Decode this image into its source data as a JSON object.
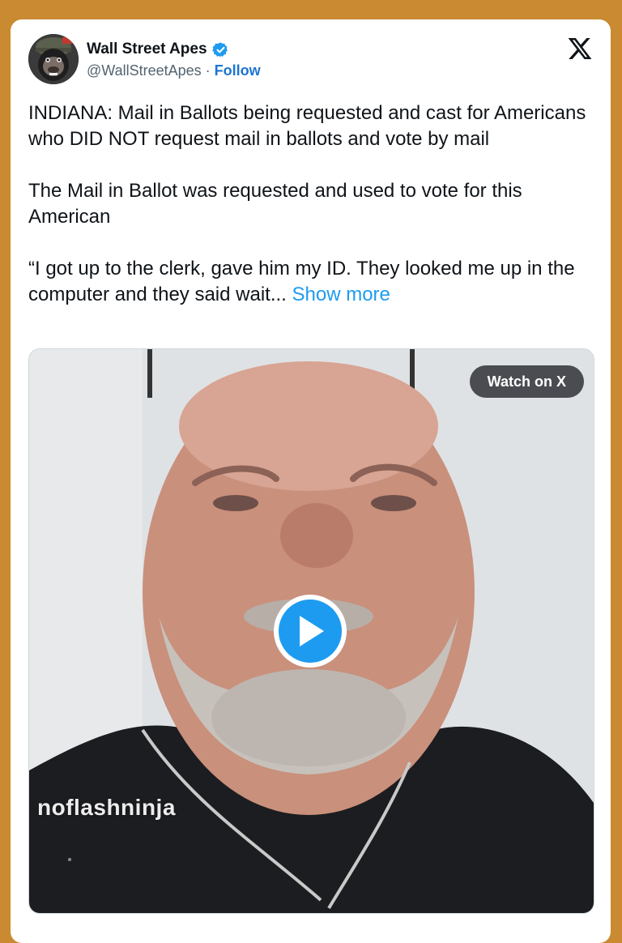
{
  "tweet": {
    "author": {
      "display_name": "Wall Street Apes",
      "handle": "@WallStreetApes",
      "separator": " · ",
      "follow_label": "Follow",
      "verified": true
    },
    "paragraphs": [
      "INDIANA: Mail in Ballots being requested and cast for Americans who DID NOT request mail in ballots and vote by mail",
      "The Mail in Ballot was requested and used to vote for this American",
      "“I got up to the clerk, gave him my ID. They looked me up in the computer and they said wait..."
    ],
    "show_more_label": "Show more"
  },
  "media": {
    "watch_label": "Watch on X",
    "watermark": "noflashninja"
  },
  "colors": {
    "page_background": "#c98a31",
    "link_blue": "#1d9bf0",
    "follow_blue": "#1d74d0",
    "verified_blue": "#1d9bf0"
  }
}
